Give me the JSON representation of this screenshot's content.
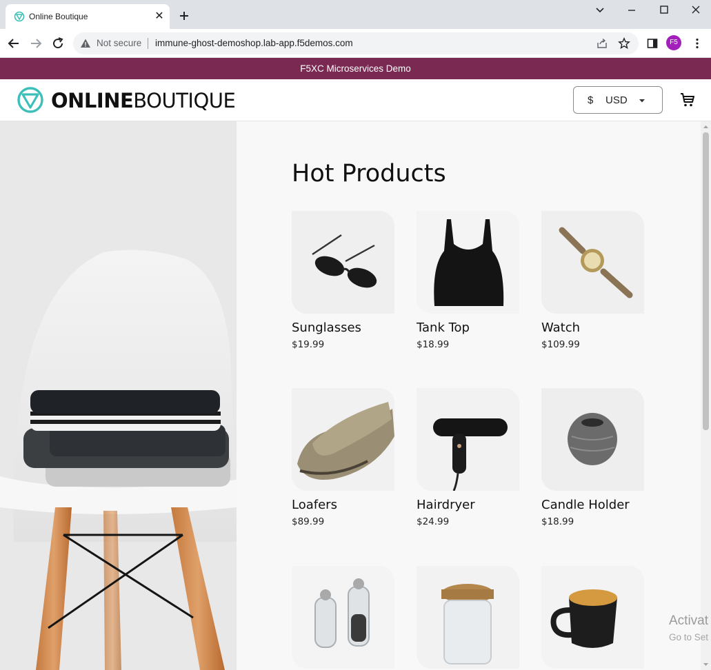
{
  "browser": {
    "tab_title": "Online Boutique",
    "omnibox": {
      "security_label": "Not secure",
      "url": "immune-ghost-demoshop.lab-app.f5demos.com"
    },
    "profile_initials": "F5"
  },
  "banner": {
    "text": "F5XC Microservices Demo"
  },
  "header": {
    "logo": {
      "strong": "ONLINE",
      "light": "BOUTIQUE"
    },
    "currency": {
      "symbol": "$",
      "code": "USD"
    }
  },
  "main": {
    "title": "Hot Products",
    "products": [
      {
        "name": "Sunglasses",
        "price": "$19.99",
        "icon": "sunglasses"
      },
      {
        "name": "Tank Top",
        "price": "$18.99",
        "icon": "tank-top"
      },
      {
        "name": "Watch",
        "price": "$109.99",
        "icon": "watch"
      },
      {
        "name": "Loafers",
        "price": "$89.99",
        "icon": "loafers"
      },
      {
        "name": "Hairdryer",
        "price": "$24.99",
        "icon": "hairdryer"
      },
      {
        "name": "Candle Holder",
        "price": "$18.99",
        "icon": "candle-holder"
      },
      {
        "name": "",
        "price": "",
        "icon": "salt-pepper-shakers"
      },
      {
        "name": "",
        "price": "",
        "icon": "glass-jar"
      },
      {
        "name": "",
        "price": "",
        "icon": "mug"
      }
    ]
  },
  "watermark": {
    "title": "Activat",
    "subtitle": "Go to Set"
  },
  "colors": {
    "banner": "#7a2a52",
    "logo_accent": "#3bbfb8",
    "profile": "#a31fbc"
  }
}
